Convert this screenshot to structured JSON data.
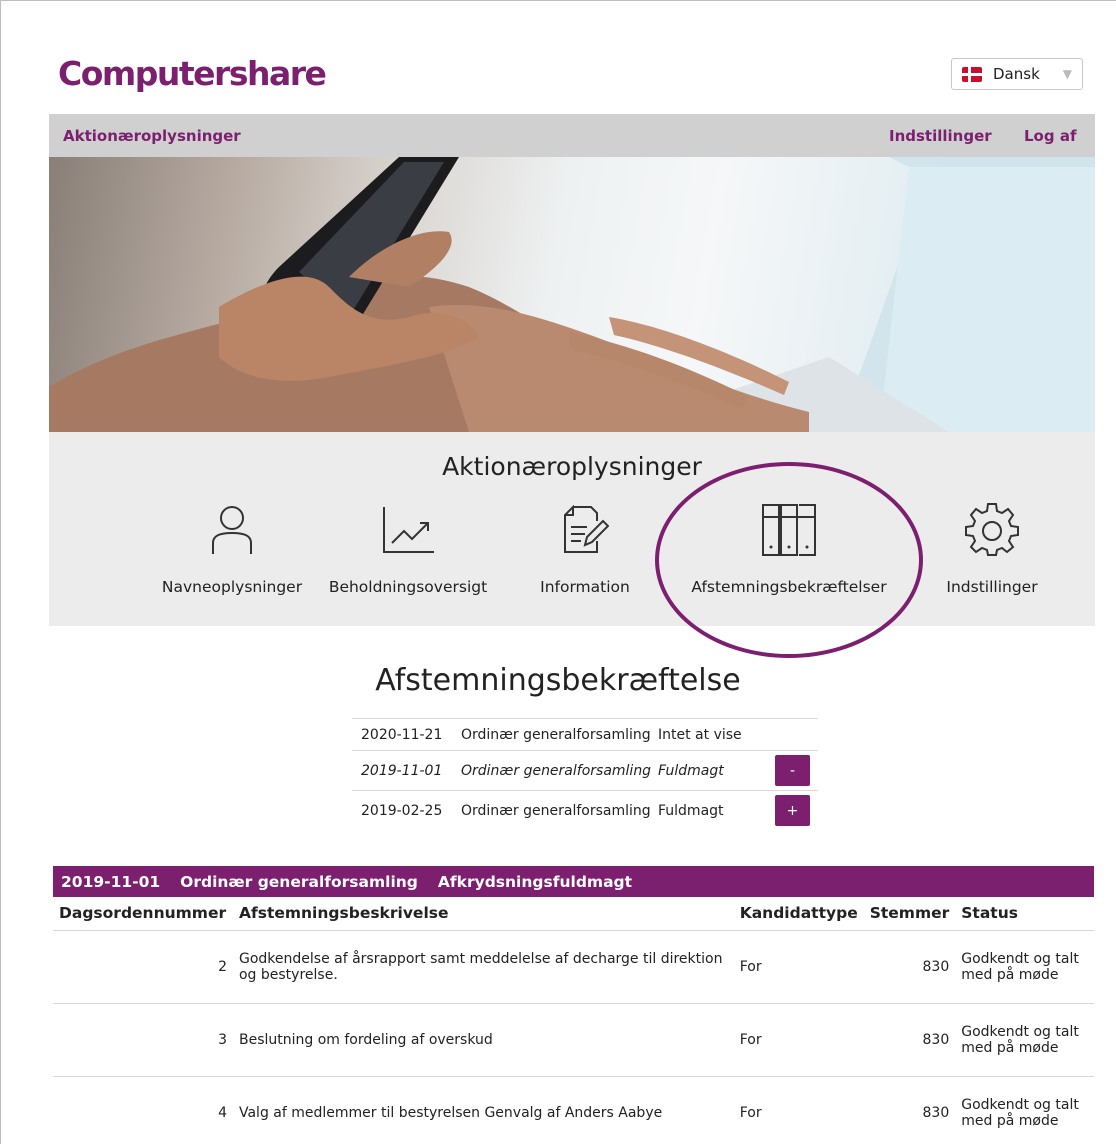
{
  "header": {
    "logo_text": "Computershare",
    "language": "Dansk"
  },
  "navbar": {
    "left": "Aktionæroplysninger",
    "settings": "Indstillinger",
    "logout": "Log af"
  },
  "quick": {
    "title": "Aktionæroplysninger",
    "items": [
      {
        "label": "Navneoplysninger",
        "icon": "person-icon"
      },
      {
        "label": "Beholdningsoversigt",
        "icon": "chart-line-icon"
      },
      {
        "label": "Information",
        "icon": "document-edit-icon"
      },
      {
        "label": "Afstemningsbekræftelser",
        "icon": "ballot-box-icon"
      },
      {
        "label": "Indstillinger",
        "icon": "gear-icon"
      }
    ],
    "highlight_color": "#7c1f6f"
  },
  "section": {
    "title": "Afstemningsbekræftelse",
    "meetings": [
      {
        "date": "2020-11-21",
        "type": "Ordinær generalforsamling",
        "status": "Intet at vise",
        "toggle": ""
      },
      {
        "date": "2019-11-01",
        "type": "Ordinær generalforsamling",
        "status": "Fuldmagt",
        "toggle": "-"
      },
      {
        "date": "2019-02-25",
        "type": "Ordinær generalforsamling",
        "status": "Fuldmagt",
        "toggle": "+"
      }
    ]
  },
  "detail": {
    "header": {
      "date": "2019-11-01",
      "type": "Ordinær generalforsamling",
      "kind": "Afkrydsningsfuldmagt"
    },
    "columns": [
      "Dagsordennummer",
      "Afstemningsbeskrivelse",
      "Kandidattype",
      "Stemmer",
      "Status"
    ],
    "rows": [
      {
        "num": "2",
        "desc": "Godkendelse af årsrapport samt meddelelse af decharge til direktion og bestyrelse.",
        "type": "For",
        "votes": "830",
        "status": "Godkendt og talt med på møde"
      },
      {
        "num": "3",
        "desc": "Beslutning om fordeling af overskud",
        "type": "For",
        "votes": "830",
        "status": "Godkendt og talt med på møde"
      },
      {
        "num": "4",
        "desc": "Valg af medlemmer til bestyrelsen Genvalg af Anders Aabye",
        "type": "For",
        "votes": "830",
        "status": "Godkendt og talt med på møde"
      }
    ]
  },
  "colors": {
    "brand": "#7c1f6f",
    "navbar": "#d0d0d0",
    "panel": "#ececec"
  }
}
